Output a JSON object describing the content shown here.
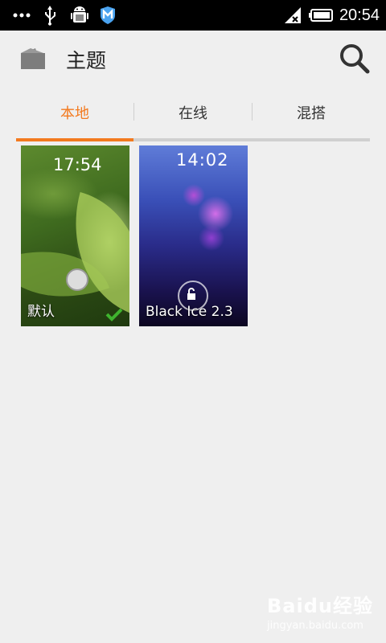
{
  "status_bar": {
    "time": "20:54",
    "icons": [
      "more-icon",
      "usb-icon",
      "android-debug-icon",
      "shield-m-icon",
      "signal-icon",
      "battery-icon"
    ]
  },
  "header": {
    "title": "主题",
    "logo_icon": "theme-cards-icon",
    "search_icon": "search-icon"
  },
  "tabs": [
    {
      "label": "本地",
      "active": true
    },
    {
      "label": "在线",
      "active": false
    },
    {
      "label": "混搭",
      "active": false
    }
  ],
  "themes": [
    {
      "name": "默认",
      "lock_clock": "17:54",
      "applied": true
    },
    {
      "name": "Black Ice 2.3",
      "lock_clock": "14:02",
      "applied": false
    }
  ],
  "colors": {
    "accent": "#f37a1f",
    "background": "#efefef",
    "check": "#3fb42e"
  },
  "watermark": {
    "brand": "Baidu经验",
    "url": "jingyan.baidu.com"
  }
}
